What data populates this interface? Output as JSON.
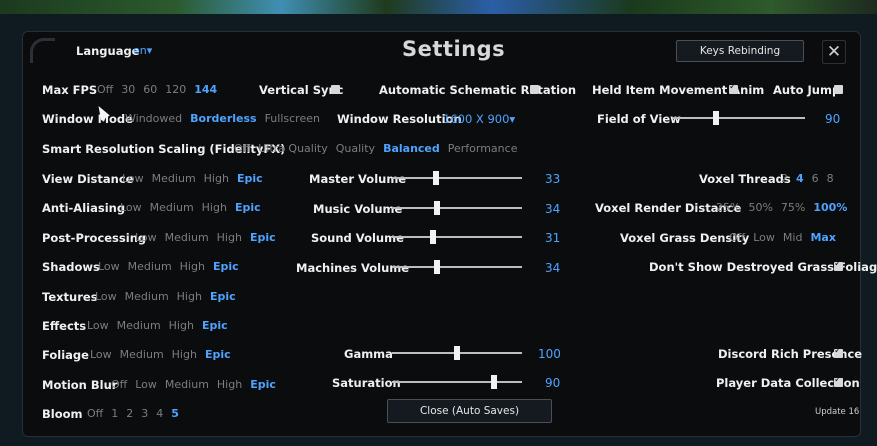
{
  "title": "Settings",
  "keys_button": "Keys Rebinding",
  "close_button": "Close (Auto Saves)",
  "version": "Update 16",
  "language": {
    "label": "Language",
    "value": "en▾"
  },
  "max_fps": {
    "label": "Max FPS",
    "options": [
      "Off",
      "30",
      "60",
      "120",
      "144"
    ],
    "selected": 4
  },
  "vsync": {
    "label": "Vertical Sync",
    "checked": false
  },
  "auto_rotation": {
    "label": "Automatic Schematic Rotation",
    "checked": false
  },
  "held_item": {
    "label": "Held Item Movement Anim",
    "checked": true
  },
  "auto_jump": {
    "label": "Auto Jump",
    "checked": false
  },
  "window_mode": {
    "label": "Window Mode",
    "options": [
      "Windowed",
      "Borderless",
      "Fullscreen"
    ],
    "selected": 1
  },
  "window_resolution": {
    "label": "Window Resolution",
    "value": "1600 X 900▾"
  },
  "fov": {
    "label": "Field of View",
    "value": "90",
    "fraction": 0.32
  },
  "fsr": {
    "label": "Smart Resolution Scaling (FidelityFX)",
    "options": [
      "Off",
      "Ultra Quality",
      "Quality",
      "Balanced",
      "Performance"
    ],
    "selected": 3
  },
  "quality_rows": [
    {
      "label": "View Distance",
      "options": [
        "Low",
        "Medium",
        "High",
        "Epic"
      ],
      "selected": 3
    },
    {
      "label": "Anti-Aliasing",
      "options": [
        "Low",
        "Medium",
        "High",
        "Epic"
      ],
      "selected": 3
    },
    {
      "label": "Post-Processing",
      "options": [
        "Low",
        "Medium",
        "High",
        "Epic"
      ],
      "selected": 3
    },
    {
      "label": "Shadows",
      "options": [
        "Low",
        "Medium",
        "High",
        "Epic"
      ],
      "selected": 3
    },
    {
      "label": "Textures",
      "options": [
        "Low",
        "Medium",
        "High",
        "Epic"
      ],
      "selected": 3
    },
    {
      "label": "Effects",
      "options": [
        "Low",
        "Medium",
        "High",
        "Epic"
      ],
      "selected": 3
    },
    {
      "label": "Foliage",
      "options": [
        "Low",
        "Medium",
        "High",
        "Epic"
      ],
      "selected": 3
    },
    {
      "label": "Motion Blur",
      "options": [
        "Off",
        "Low",
        "Medium",
        "High",
        "Epic"
      ],
      "selected": 4
    },
    {
      "label": "Bloom",
      "options": [
        "Off",
        "1",
        "2",
        "3",
        "4",
        "5"
      ],
      "selected": 5
    }
  ],
  "volumes": [
    {
      "label": "Master Volume",
      "value": "33",
      "fraction": 0.33
    },
    {
      "label": "Music Volume",
      "value": "34",
      "fraction": 0.34
    },
    {
      "label": "Sound Volume",
      "value": "31",
      "fraction": 0.31
    },
    {
      "label": "Machines Volume",
      "value": "34",
      "fraction": 0.34
    }
  ],
  "gamma": {
    "label": "Gamma",
    "value": "100",
    "fraction": 0.5
  },
  "saturation": {
    "label": "Saturation",
    "value": "90",
    "fraction": 0.8
  },
  "voxel_threads": {
    "label": "Voxel Threads",
    "options": [
      "2",
      "4",
      "6",
      "8"
    ],
    "selected": 1
  },
  "voxel_render": {
    "label": "Voxel Render Distance",
    "options": [
      "25%",
      "50%",
      "75%",
      "100%"
    ],
    "selected": 3
  },
  "voxel_grass": {
    "label": "Voxel Grass Density",
    "options": [
      "Off",
      "Low",
      "Mid",
      "Max"
    ],
    "selected": 3
  },
  "grass_foliage": {
    "label": "Don't Show Destroyed Grass Foliage",
    "checked": true
  },
  "discord": {
    "label": "Discord Rich Presence",
    "checked": true
  },
  "player_data": {
    "label": "Player Data Collection",
    "checked": true
  },
  "colors": {
    "accent": "#4fa3ff",
    "panel": "#0a0c0e",
    "text": "#f0f0f0",
    "muted": "#7d7d7d"
  }
}
